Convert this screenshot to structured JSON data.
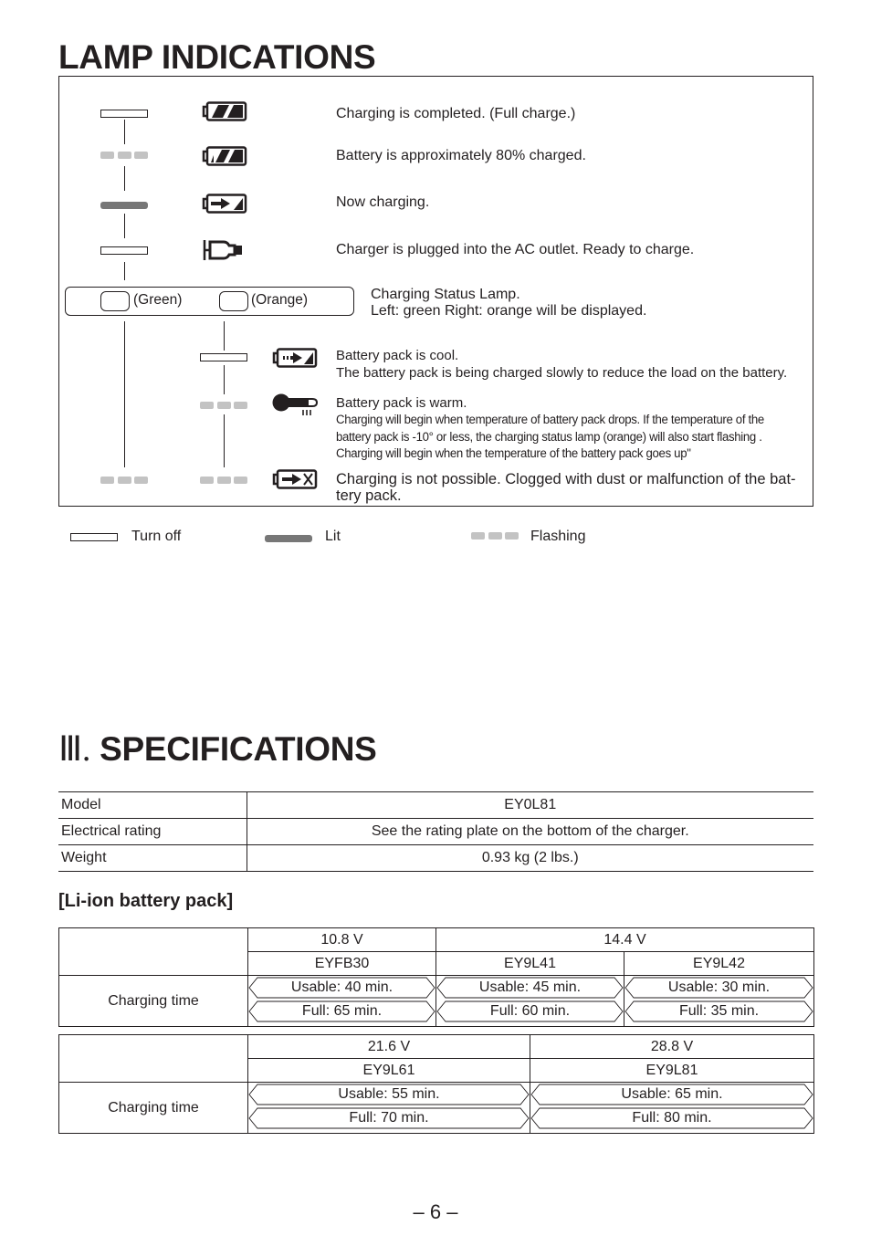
{
  "lamp_indications": {
    "title": "LAMP INDICATIONS",
    "rows": [
      {
        "lamp_state": "off",
        "icon": "battery-full-icon",
        "text": "Charging is completed. (Full charge.)"
      },
      {
        "lamp_state": "flashing",
        "icon": "battery-80-icon",
        "text": "Battery is approximately 80% charged."
      },
      {
        "lamp_state": "lit",
        "icon": "battery-charging-icon",
        "text": "Now charging."
      },
      {
        "lamp_state": "off",
        "icon": "ac-plug-icon",
        "text": "Charger is plugged into the AC outlet. Ready to charge."
      }
    ],
    "status_lamp": {
      "green_label": "(Green)",
      "orange_label": "(Orange)",
      "line1": "Charging Status Lamp.",
      "line2": "Left: green  Right: orange will be displayed."
    },
    "orange_rows": [
      {
        "green_state": "none",
        "orange_state": "off",
        "icon": "battery-slow-charge-icon",
        "lines": [
          "Battery pack is cool.",
          "The battery pack is being charged slowly to reduce the load on the battery."
        ]
      },
      {
        "green_state": "none",
        "orange_state": "flashing",
        "icon": "thermometer-warm-icon",
        "lines": [
          "Battery pack is warm.",
          "Charging will begin when temperature of battery pack drops. If the temperature of the",
          "battery pack is -10° or less, the charging status lamp (orange) will also start flashing .",
          "Charging will begin when the temperature of the battery pack goes up\""
        ]
      },
      {
        "green_state": "flashing",
        "orange_state": "flashing",
        "icon": "battery-error-icon",
        "lines": [
          "Charging is not possible. Clogged with dust or malfunction of the bat-",
          "tery pack."
        ]
      }
    ],
    "legend": {
      "off": "Turn off",
      "lit": "Lit",
      "flashing": "Flashing"
    }
  },
  "specifications": {
    "numeral": "Ⅲ.",
    "title": "SPECIFICATIONS",
    "table": [
      {
        "key": "Model",
        "value": "EY0L81"
      },
      {
        "key": "Electrical rating",
        "value": "See the rating plate on the bottom of the charger."
      },
      {
        "key": "Weight",
        "value": "0.93 kg (2 lbs.)"
      }
    ],
    "battery_heading": "[Li-ion battery pack]",
    "battery_table_1": {
      "voltages": [
        "10.8 V",
        "14.4 V"
      ],
      "models": [
        "EYFB30",
        "EY9L41",
        "EY9L42"
      ],
      "row_label": "Charging time",
      "usable": [
        "Usable: 40 min.",
        "Usable: 45 min.",
        "Usable: 30 min."
      ],
      "full": [
        "Full: 65 min.",
        "Full: 60 min.",
        "Full: 35 min."
      ]
    },
    "battery_table_2": {
      "voltages": [
        "21.6 V",
        "28.8 V"
      ],
      "models": [
        "EY9L61",
        "EY9L81"
      ],
      "row_label": "Charging time",
      "usable": [
        "Usable: 55 min.",
        "Usable: 65 min."
      ],
      "full": [
        "Full: 70 min.",
        "Full: 80 min."
      ]
    }
  },
  "page_number": "– 6 –"
}
